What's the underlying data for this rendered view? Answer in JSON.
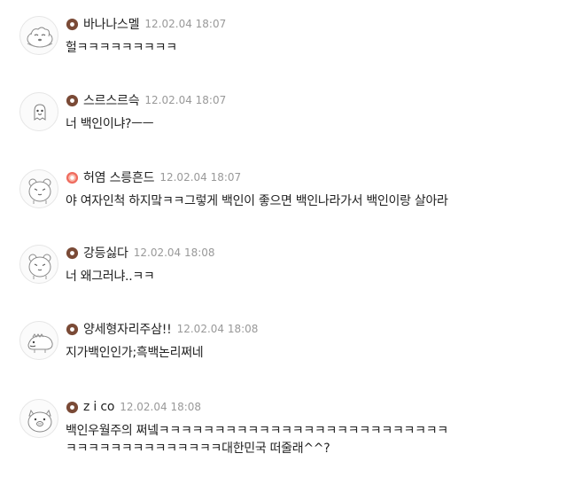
{
  "comments": [
    {
      "name": "바나나스멜",
      "time": "12.02.04 18:07",
      "text": "헐ㅋㅋㅋㅋㅋㅋㅋㅋㅋ",
      "badge": "brown-donut-icon",
      "avatar": "sleeping-animal-avatar"
    },
    {
      "name": "스르스르슥",
      "time": "12.02.04 18:07",
      "text": "너 백인이냐?ㅡㅡ",
      "badge": "brown-donut-icon",
      "avatar": "small-ghost-avatar"
    },
    {
      "name": "허염 스릉흔드",
      "time": "12.02.04 18:07",
      "text": "야 여자인척 하지맠ㅋㅋ그렇게 백인이 좋으면 백인나라가서 백인이랑 살아라",
      "badge": "pink-donut-icon",
      "avatar": "bear-avatar"
    },
    {
      "name": "강등싫다",
      "time": "12.02.04 18:08",
      "text": "너 왜그러냐..ㅋㅋ",
      "badge": "brown-donut-icon",
      "avatar": "bear-avatar"
    },
    {
      "name": "양세형자리주삼!!",
      "time": "12.02.04 18:08",
      "text": "지가백인인가;흑백논리쩌네",
      "badge": "brown-donut-icon",
      "avatar": "dinosaur-avatar"
    },
    {
      "name": "z i co",
      "time": "12.02.04 18:08",
      "text": "백인우월주의 쩌넼ㅋㅋㅋㅋㅋㅋㅋㅋㅋㅋㅋㅋㅋㅋㅋㅋㅋㅋㅋㅋㅋㅋㅋㅋㅋㅋ\nㅋㅋㅋㅋㅋㅋㅋㅋㅋㅋㅋㅋㅋㅋ대한민국 떠줄래^^?",
      "badge": "brown-donut-icon",
      "avatar": "pig-avatar"
    }
  ],
  "colors": {
    "badge_brown": "#7a4a36",
    "badge_pink": "#ef6b5e",
    "timestamp": "#999999",
    "text": "#222222"
  }
}
